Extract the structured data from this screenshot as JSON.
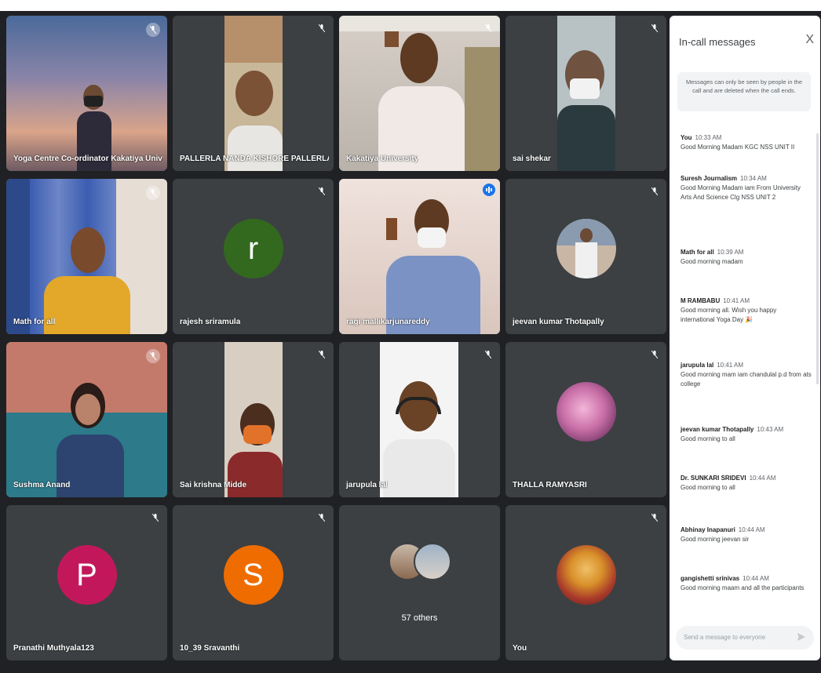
{
  "tiles": [
    {
      "name": "Yoga Centre Co-ordinator Kakatiya University"
    },
    {
      "name": "PALLERLA NANDA KISHORE PALLERLA NANDA KI..."
    },
    {
      "name": "Kakatiya University"
    },
    {
      "name": "sai shekar"
    },
    {
      "name": "Math for all"
    },
    {
      "name": "rajesh sriramula",
      "initial": "r"
    },
    {
      "name": "ragi mallikarjunareddy"
    },
    {
      "name": "jeevan kumar Thotapally"
    },
    {
      "name": "Sushma Anand"
    },
    {
      "name": "Sai krishna Midde"
    },
    {
      "name": "jarupula lal"
    },
    {
      "name": "THALLA RAMYASRI"
    },
    {
      "name": "Pranathi Muthyala123",
      "initial": "P"
    },
    {
      "name": "10_39 Sravanthi",
      "initial": "S"
    },
    {
      "name": "57 others"
    },
    {
      "name": "You"
    }
  ],
  "chat": {
    "title": "In-call messages",
    "close": "X",
    "info": "Messages can only be seen by people in the call and are deleted when the call ends.",
    "messages": [
      {
        "sender": "You",
        "time": "10:33 AM",
        "text": "Good Morning Madam KGC NSS UNIT II"
      },
      {
        "sender": "Suresh Journalism",
        "time": "10:34 AM",
        "text": "Good Morning Madam iam From University Arts And Science Clg NSS UNIT 2"
      },
      {
        "sender": "Math for all",
        "time": "10:39 AM",
        "text": "Good morning madam"
      },
      {
        "sender": "M RAMBABU",
        "time": "10:41 AM",
        "text": "Good morning all. Wish you happy international Yoga Day"
      },
      {
        "sender": "jarupula lal",
        "time": "10:41 AM",
        "text": "Good morning mam iam chandulal p.d from ats college"
      },
      {
        "sender": "jeevan kumar Thotapally",
        "time": "10:43 AM",
        "text": "Good morning to all"
      },
      {
        "sender": "Dr. SUNKARI SRIDEVI",
        "time": "10:44 AM",
        "text": "Good morning to all"
      },
      {
        "sender": "Abhinay Inapanuri",
        "time": "10:44 AM",
        "text": "Good morning jeevan sir"
      },
      {
        "sender": "gangishetti srinivas",
        "time": "10:44 AM",
        "text": "Good morning maam and all the participants"
      }
    ],
    "compose_placeholder": "Send a message to everyone"
  },
  "colors": {
    "background": "#202124",
    "tile": "#3c4043",
    "active_speaker": "#8ab4f8",
    "avatar_r": "#33691e",
    "avatar_p": "#c2185b",
    "avatar_s": "#ef6c00"
  }
}
